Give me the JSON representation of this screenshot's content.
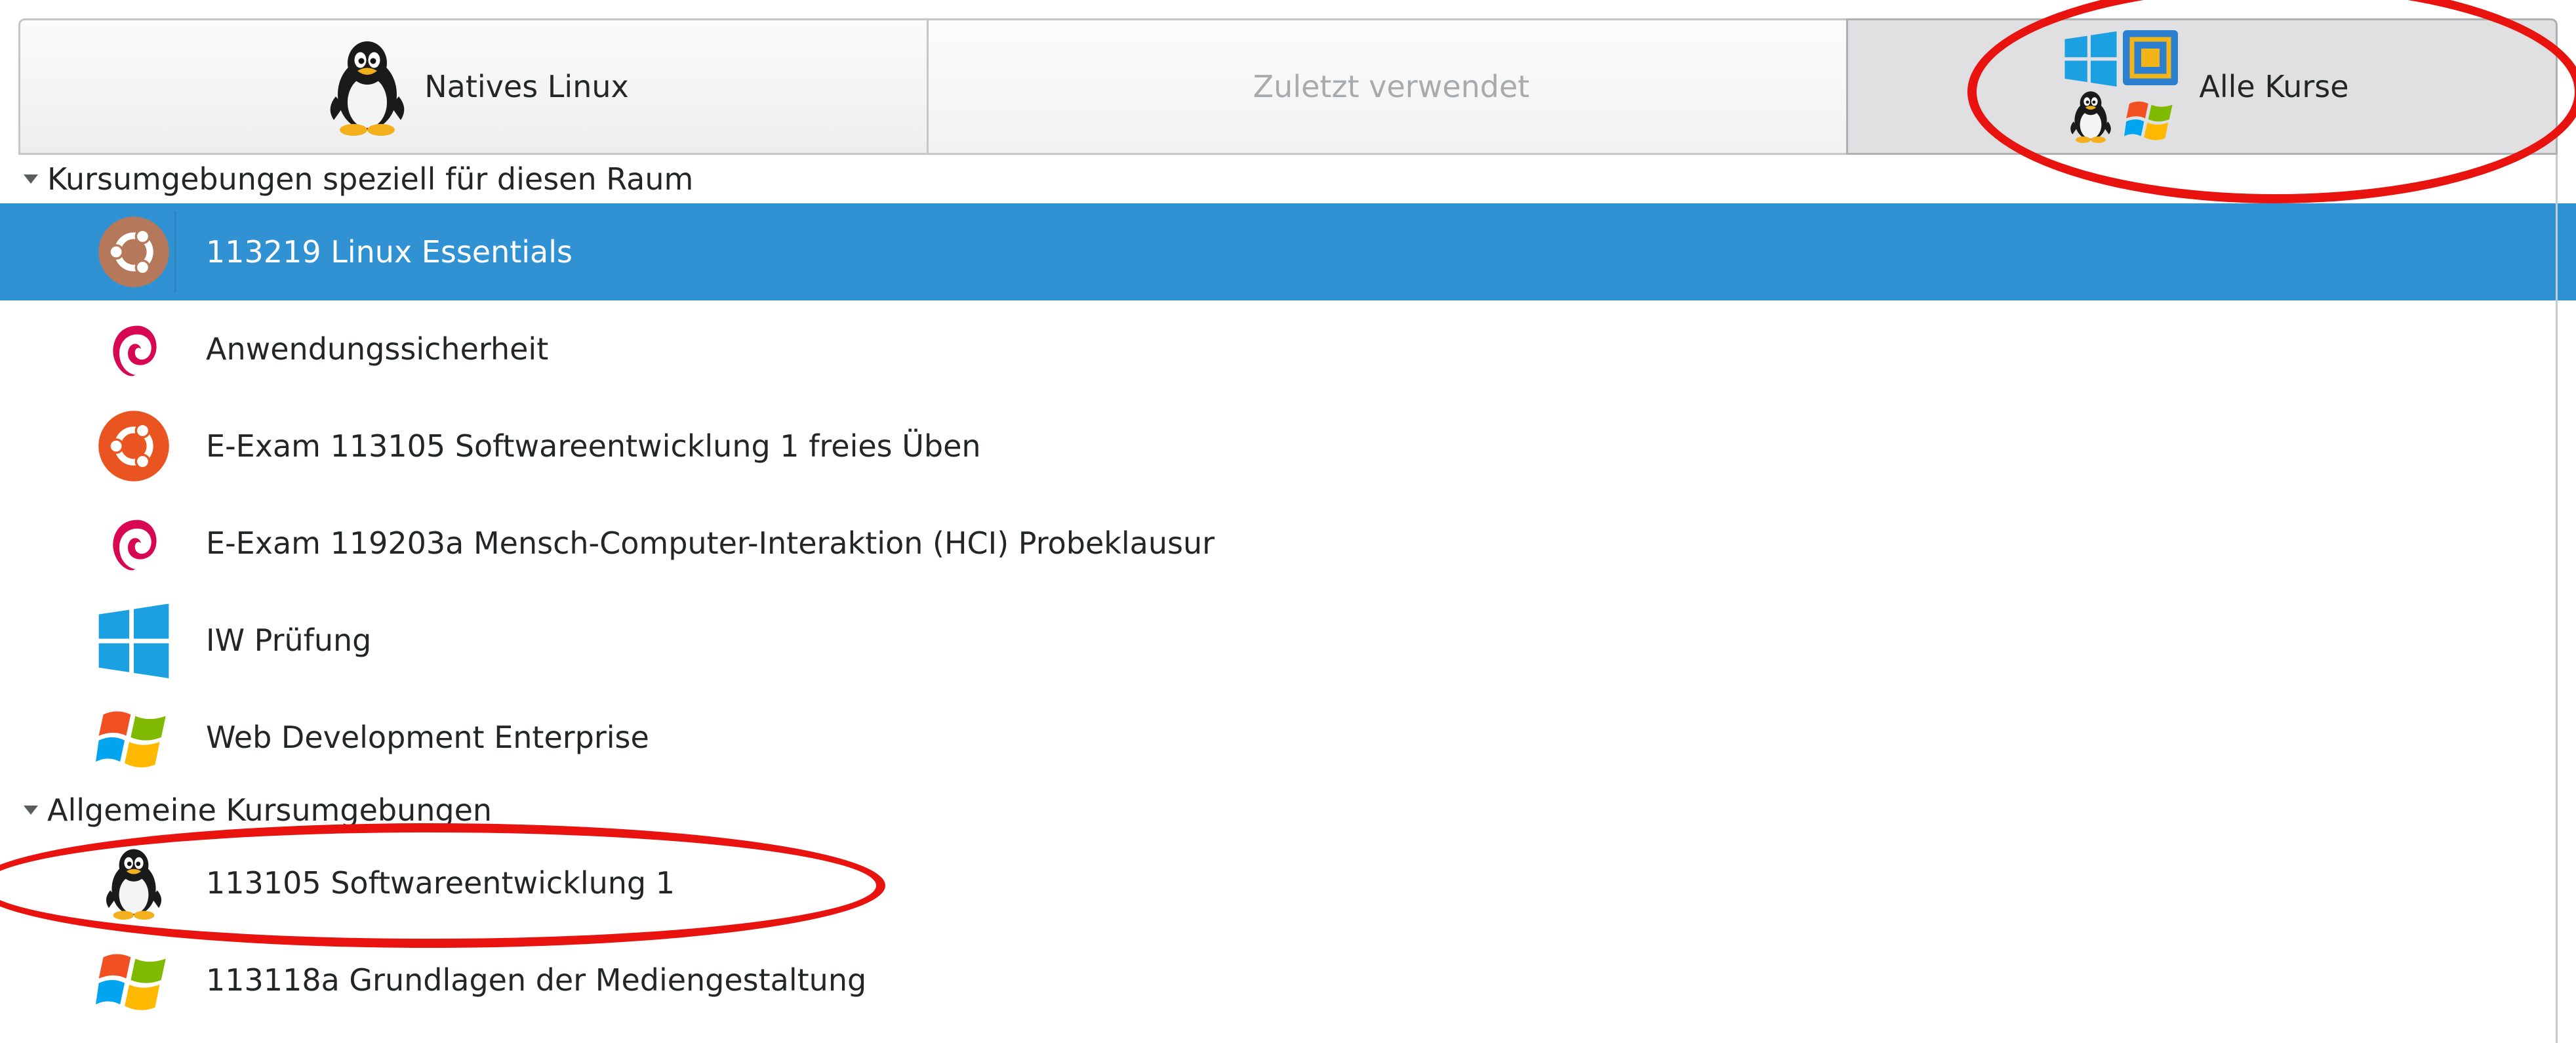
{
  "tabs": [
    {
      "label": "Natives Linux",
      "icon": "tux-icon"
    },
    {
      "label": "Zuletzt verwendet"
    },
    {
      "label": "Alle Kurse",
      "icon": "multi-os-icon"
    }
  ],
  "groups": [
    {
      "title": "Kursumgebungen speziell für diesen Raum",
      "items": [
        {
          "label": "113219 Linux Essentials",
          "icon": "ubuntu-icon",
          "selected": true
        },
        {
          "label": "Anwendungssicherheit",
          "icon": "debian-icon"
        },
        {
          "label": "E-Exam 113105 Softwareentwicklung 1 freies Üben",
          "icon": "ubuntu-icon"
        },
        {
          "label": "E-Exam 119203a Mensch-Computer-Interaktion (HCI) Probeklausur",
          "icon": "debian-icon"
        },
        {
          "label": "IW Prüfung",
          "icon": "windows10-icon"
        },
        {
          "label": "Web Development Enterprise",
          "icon": "windows7-icon"
        }
      ]
    },
    {
      "title": "Allgemeine Kursumgebungen",
      "items": [
        {
          "label": "113105 Softwareentwicklung 1",
          "icon": "tux-icon"
        },
        {
          "label": "113118a Grundlagen der Mediengestaltung",
          "icon": "windows7-icon"
        }
      ]
    }
  ],
  "colors": {
    "selection": "#3092d3",
    "annotation": "#e8130f",
    "ubuntu": "#e95420",
    "debian": "#d70751"
  }
}
